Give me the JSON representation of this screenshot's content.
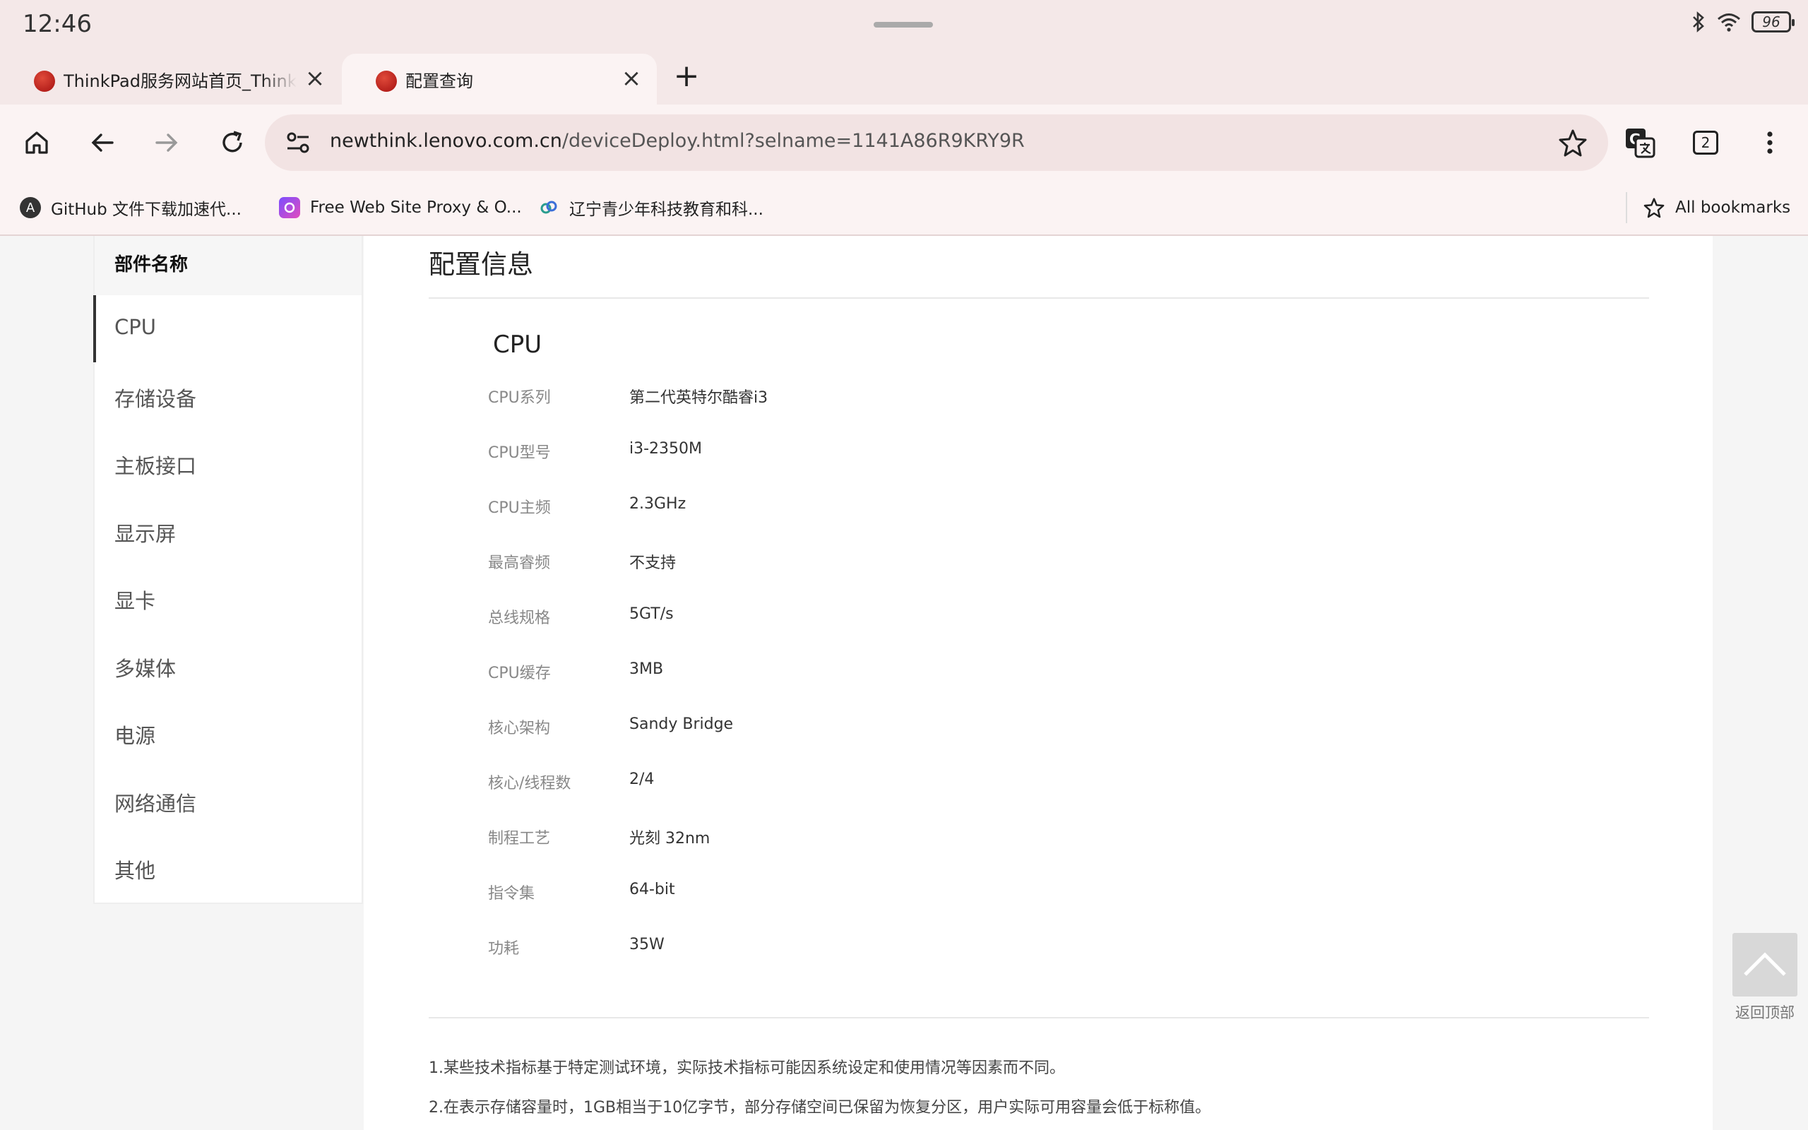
{
  "status_bar": {
    "time": "12:46",
    "battery": "96"
  },
  "tabs": [
    {
      "title": "ThinkPad服务网站首页_ThinkPad服务",
      "active": false
    },
    {
      "title": "配置查询",
      "active": true
    }
  ],
  "omnibox": {
    "host": "newthink.lenovo.com.cn",
    "path": "/deviceDeploy.html?selname=1141A86R9KRY9R"
  },
  "toolbar": {
    "tab_count": "2"
  },
  "bookmarks": [
    {
      "label": "GitHub 文件下载加速代...",
      "icon": "A"
    },
    {
      "label": "Free Web Site Proxy & O...",
      "icon": ""
    },
    {
      "label": "辽宁青少年科技教育和科...",
      "icon": ""
    }
  ],
  "all_bookmarks_label": "All bookmarks",
  "sidebar": {
    "header": "部件名称",
    "items": [
      "CPU",
      "存储设备",
      "主板接口",
      "显示屏",
      "显卡",
      "多媒体",
      "电源",
      "网络通信",
      "其他"
    ]
  },
  "main": {
    "section_title": "配置信息",
    "group_title": "CPU",
    "specs": [
      {
        "label": "CPU系列",
        "value": "第二代英特尔酷睿i3"
      },
      {
        "label": "CPU型号",
        "value": "i3-2350M"
      },
      {
        "label": "CPU主频",
        "value": "2.3GHz"
      },
      {
        "label": "最高睿频",
        "value": "不支持"
      },
      {
        "label": "总线规格",
        "value": "5GT/s"
      },
      {
        "label": "CPU缓存",
        "value": "3MB"
      },
      {
        "label": "核心架构",
        "value": "Sandy Bridge"
      },
      {
        "label": "核心/线程数",
        "value": "2/4"
      },
      {
        "label": "制程工艺",
        "value": "光刻 32nm"
      },
      {
        "label": "指令集",
        "value": "64-bit"
      },
      {
        "label": "功耗",
        "value": "35W"
      }
    ],
    "notes": [
      "1.某些技术指标基于特定测试环境，实际技术指标可能因系统设定和使用情况等因素而不同。",
      "2.在表示存储容量时，1GB相当于10亿字节，部分存储空间已保留为恢复分区，用户实际可用容量会低于标称值。"
    ]
  },
  "back_to_top_label": "返回顶部"
}
